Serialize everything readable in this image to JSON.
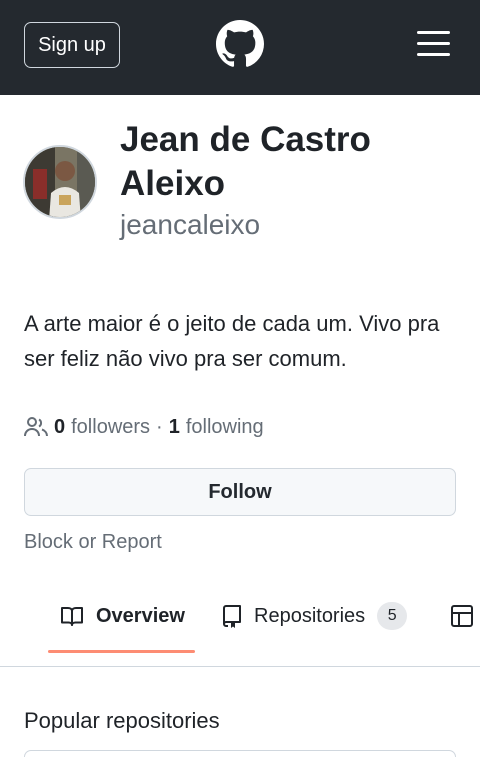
{
  "header": {
    "signup_label": "Sign up",
    "logo_icon": "github-mark-icon",
    "menu_icon": "hamburger-menu-icon",
    "background": "#24292f"
  },
  "profile": {
    "full_name": "Jean de Castro Aleixo",
    "username": "jeancaleixo",
    "bio": "A arte maior é o jeito de cada um. Vivo pra ser feliz não vivo pra ser comum.",
    "followers_count": "0",
    "followers_label": "followers",
    "separator": "·",
    "following_count": "1",
    "following_label": "following"
  },
  "actions": {
    "follow_label": "Follow",
    "block_label": "Block or Report"
  },
  "tabs": [
    {
      "label": "Overview",
      "icon": "book-icon",
      "selected": true
    },
    {
      "label": "Repositories",
      "icon": "repo-icon",
      "count": "5"
    },
    {
      "label": "",
      "icon": "table-icon"
    }
  ],
  "sections": {
    "popular_title": "Popular repositories"
  },
  "colors": {
    "accent_underline": "#fd8c73",
    "muted_text": "#656d76"
  }
}
